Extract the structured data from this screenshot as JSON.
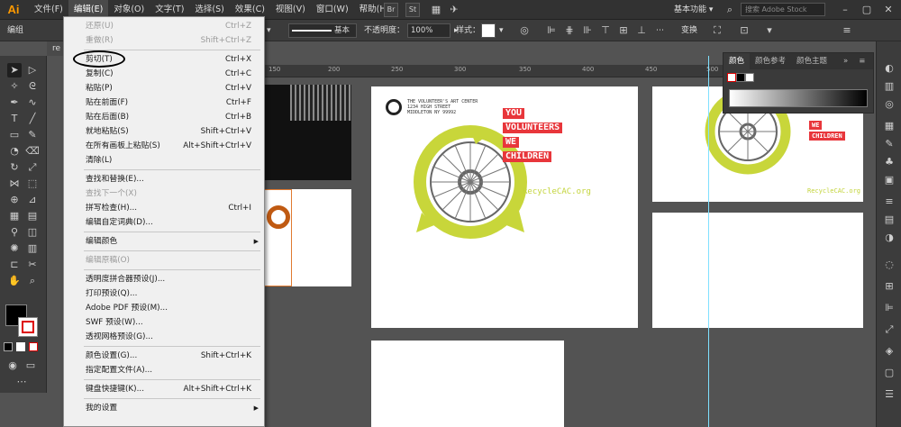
{
  "app": {
    "logo": "Ai"
  },
  "menubar": {
    "items": [
      "文件(F)",
      "编辑(E)",
      "对象(O)",
      "文字(T)",
      "选择(S)",
      "效果(C)",
      "视图(V)",
      "窗口(W)",
      "帮助(H)"
    ],
    "bridge_label": "Br",
    "stock_label": "St",
    "workspace": "基本功能 ▾",
    "search_placeholder": "搜索 Adobe Stock"
  },
  "controlbar": {
    "group_label": "编组",
    "stroke_profile": "基本",
    "opacity_label": "不透明度：",
    "opacity_value": "100%",
    "style_label": "样式：",
    "transform_label": "变换"
  },
  "document": {
    "tab": "re"
  },
  "ruler": {
    "ticks": [
      "150",
      "200",
      "250",
      "300",
      "350",
      "400",
      "450",
      "500"
    ]
  },
  "artwork": {
    "org_lines": [
      "THE VOLUNTEER'S ART CENTER",
      "1234 HIGH STREET",
      "MIDDLETON NY 99992"
    ],
    "tags": [
      "YOU",
      "VOLUNTEERS",
      "WE",
      "CHILDREN"
    ],
    "right_tags": [
      "WE",
      "CHILDREN"
    ],
    "url": "RecycleCAC.org"
  },
  "color_panel": {
    "tabs": [
      "颜色",
      "颜色参考",
      "颜色主题"
    ],
    "menu_icon": "≡",
    "collapse": "»"
  },
  "edit_menu": [
    {
      "label": "还原(U)",
      "shortcut": "Ctrl+Z",
      "disabled": true
    },
    {
      "label": "重做(R)",
      "shortcut": "Shift+Ctrl+Z",
      "disabled": true
    },
    {
      "sep": true
    },
    {
      "label": "剪切(T)",
      "shortcut": "Ctrl+X"
    },
    {
      "label": "复制(C)",
      "shortcut": "Ctrl+C"
    },
    {
      "label": "粘贴(P)",
      "shortcut": "Ctrl+V"
    },
    {
      "label": "贴在前面(F)",
      "shortcut": "Ctrl+F"
    },
    {
      "label": "贴在后面(B)",
      "shortcut": "Ctrl+B"
    },
    {
      "label": "就地粘贴(S)",
      "shortcut": "Shift+Ctrl+V"
    },
    {
      "label": "在所有画板上粘贴(S)",
      "shortcut": "Alt+Shift+Ctrl+V"
    },
    {
      "label": "清除(L)",
      "shortcut": ""
    },
    {
      "sep": true
    },
    {
      "label": "查找和替换(E)...",
      "shortcut": ""
    },
    {
      "label": "查找下一个(X)",
      "shortcut": "",
      "disabled": true
    },
    {
      "label": "拼写检查(H)...",
      "shortcut": "Ctrl+I"
    },
    {
      "label": "编辑自定词典(D)...",
      "shortcut": ""
    },
    {
      "sep": true
    },
    {
      "label": "编辑颜色",
      "shortcut": "",
      "submenu": true
    },
    {
      "sep": true
    },
    {
      "label": "编辑原稿(O)",
      "shortcut": "",
      "disabled": true
    },
    {
      "sep": true
    },
    {
      "label": "透明度拼合器预设(J)...",
      "shortcut": ""
    },
    {
      "label": "打印预设(Q)...",
      "shortcut": ""
    },
    {
      "label": "Adobe PDF 预设(M)...",
      "shortcut": ""
    },
    {
      "label": "SWF 预设(W)...",
      "shortcut": ""
    },
    {
      "label": "透视网格预设(G)...",
      "shortcut": ""
    },
    {
      "sep": true
    },
    {
      "label": "颜色设置(G)...",
      "shortcut": "Shift+Ctrl+K"
    },
    {
      "label": "指定配置文件(A)...",
      "shortcut": ""
    },
    {
      "sep": true
    },
    {
      "label": "键盘快捷键(K)...",
      "shortcut": "Alt+Shift+Ctrl+K"
    },
    {
      "sep": true
    },
    {
      "label": "我的设置",
      "shortcut": "",
      "submenu": true
    }
  ],
  "colors": {
    "accent_yellow": "#c8d63a",
    "tag_red": "#e8363b",
    "guide": "#7fe0ff"
  }
}
